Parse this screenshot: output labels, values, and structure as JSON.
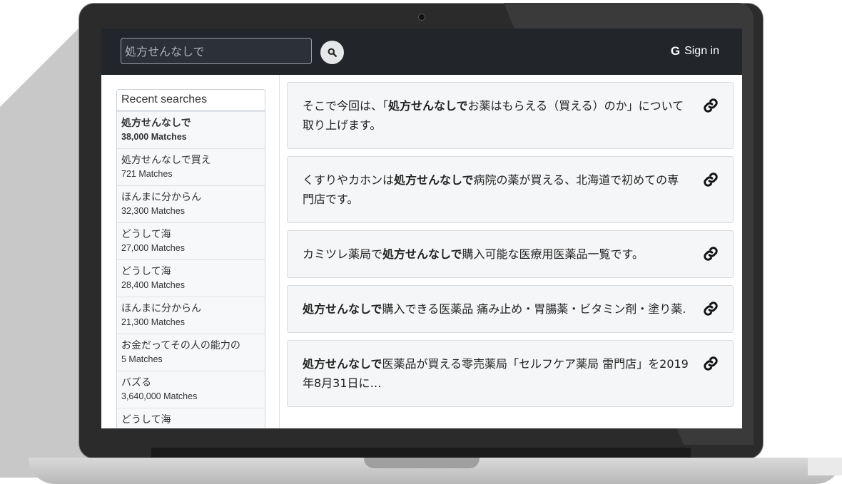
{
  "header": {
    "search_value": "処方せんなしで",
    "signin_label": "Sign in",
    "google_glyph": "G"
  },
  "sidebar": {
    "title": "Recent searches",
    "items": [
      {
        "query": "処方せんなしで",
        "matches": "38,000 Matches",
        "active": true
      },
      {
        "query": "処方せんなしで買え",
        "matches": "721 Matches"
      },
      {
        "query": "ほんまに分からん",
        "matches": "32,300 Matches"
      },
      {
        "query": "どうして海",
        "matches": "27,000 Matches"
      },
      {
        "query": "どうして海",
        "matches": "28,400 Matches"
      },
      {
        "query": "ほんまに分からん",
        "matches": "21,300 Matches"
      },
      {
        "query": "お金だってその人の能力の",
        "matches": "5 Matches"
      },
      {
        "query": "バズる",
        "matches": "3,640,000 Matches"
      },
      {
        "query": "どうして海",
        "matches": ""
      }
    ]
  },
  "results": [
    {
      "pre": "そこで今回は、「",
      "bold": "処方せんなしで",
      "post": "お薬はもらえる（買える）のか」について取り上げます。"
    },
    {
      "pre": "くすりやカホンは",
      "bold": "処方せんなしで",
      "post": "病院の薬が買える、北海道で初めての専門店です。"
    },
    {
      "pre": "カミツレ薬局で",
      "bold": "処方せんなしで",
      "post": "購入可能な医療用医薬品一覧です。"
    },
    {
      "pre": "",
      "bold": "処方せんなしで",
      "post": "購入できる医薬品 痛み止め・胃腸薬・ビタミン剤・塗り薬."
    },
    {
      "pre": "",
      "bold": "処方せんなしで",
      "post": "医薬品が買える零売薬局「セルフケア薬局 雷門店」を2019年8月31日に…"
    }
  ],
  "icons": {
    "search": "search-icon",
    "google": "google-icon",
    "link": "link-icon"
  }
}
